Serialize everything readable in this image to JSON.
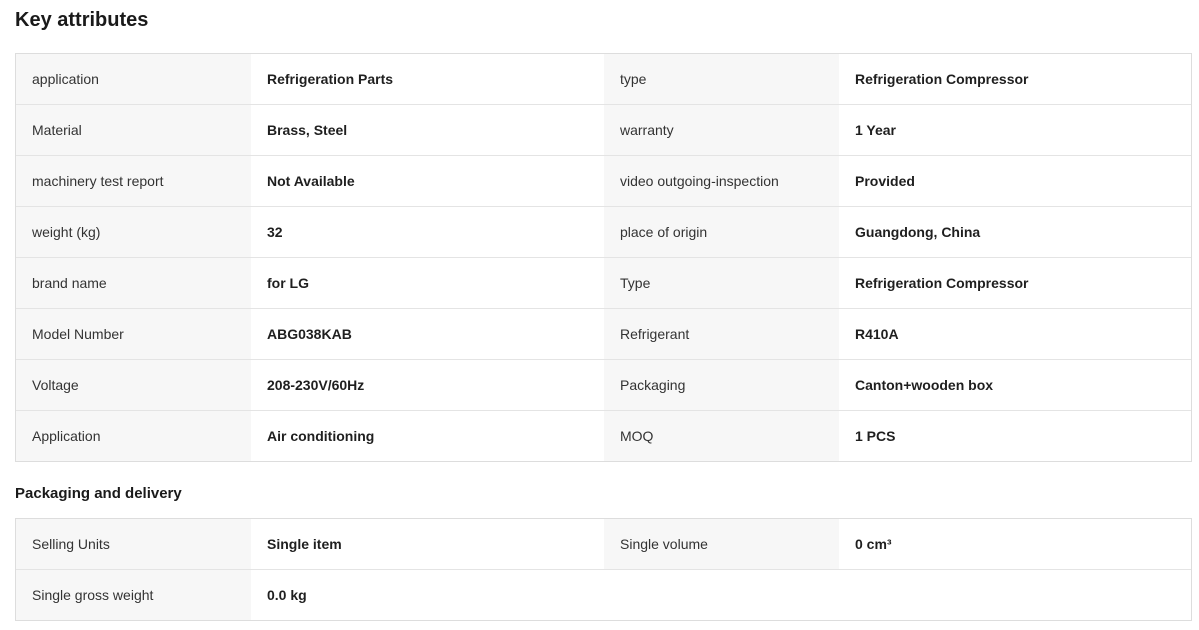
{
  "key_attributes": {
    "title": "Key attributes",
    "rows": [
      [
        {
          "label": "application",
          "value": "Refrigeration Parts"
        },
        {
          "label": "type",
          "value": "Refrigeration Compressor"
        }
      ],
      [
        {
          "label": "Material",
          "value": "Brass, Steel"
        },
        {
          "label": "warranty",
          "value": "1 Year"
        }
      ],
      [
        {
          "label": "machinery test report",
          "value": "Not Available"
        },
        {
          "label": "video outgoing-inspection",
          "value": "Provided"
        }
      ],
      [
        {
          "label": "weight (kg)",
          "value": "32"
        },
        {
          "label": "place of origin",
          "value": "Guangdong, China"
        }
      ],
      [
        {
          "label": "brand name",
          "value": "for LG"
        },
        {
          "label": "Type",
          "value": "Refrigeration Compressor"
        }
      ],
      [
        {
          "label": "Model Number",
          "value": "ABG038KAB"
        },
        {
          "label": "Refrigerant",
          "value": "R410A"
        }
      ],
      [
        {
          "label": "Voltage",
          "value": "208-230V/60Hz"
        },
        {
          "label": "Packaging",
          "value": "Canton+wooden box"
        }
      ],
      [
        {
          "label": "Application",
          "value": "Air conditioning"
        },
        {
          "label": "MOQ",
          "value": "1 PCS"
        }
      ]
    ]
  },
  "packaging_delivery": {
    "title": "Packaging and delivery",
    "rows": [
      [
        {
          "label": "Selling Units",
          "value": "Single item"
        },
        {
          "label": "Single volume",
          "value": "0 cm³"
        }
      ],
      [
        {
          "label": "Single gross weight",
          "value": "0.0 kg"
        }
      ]
    ]
  }
}
